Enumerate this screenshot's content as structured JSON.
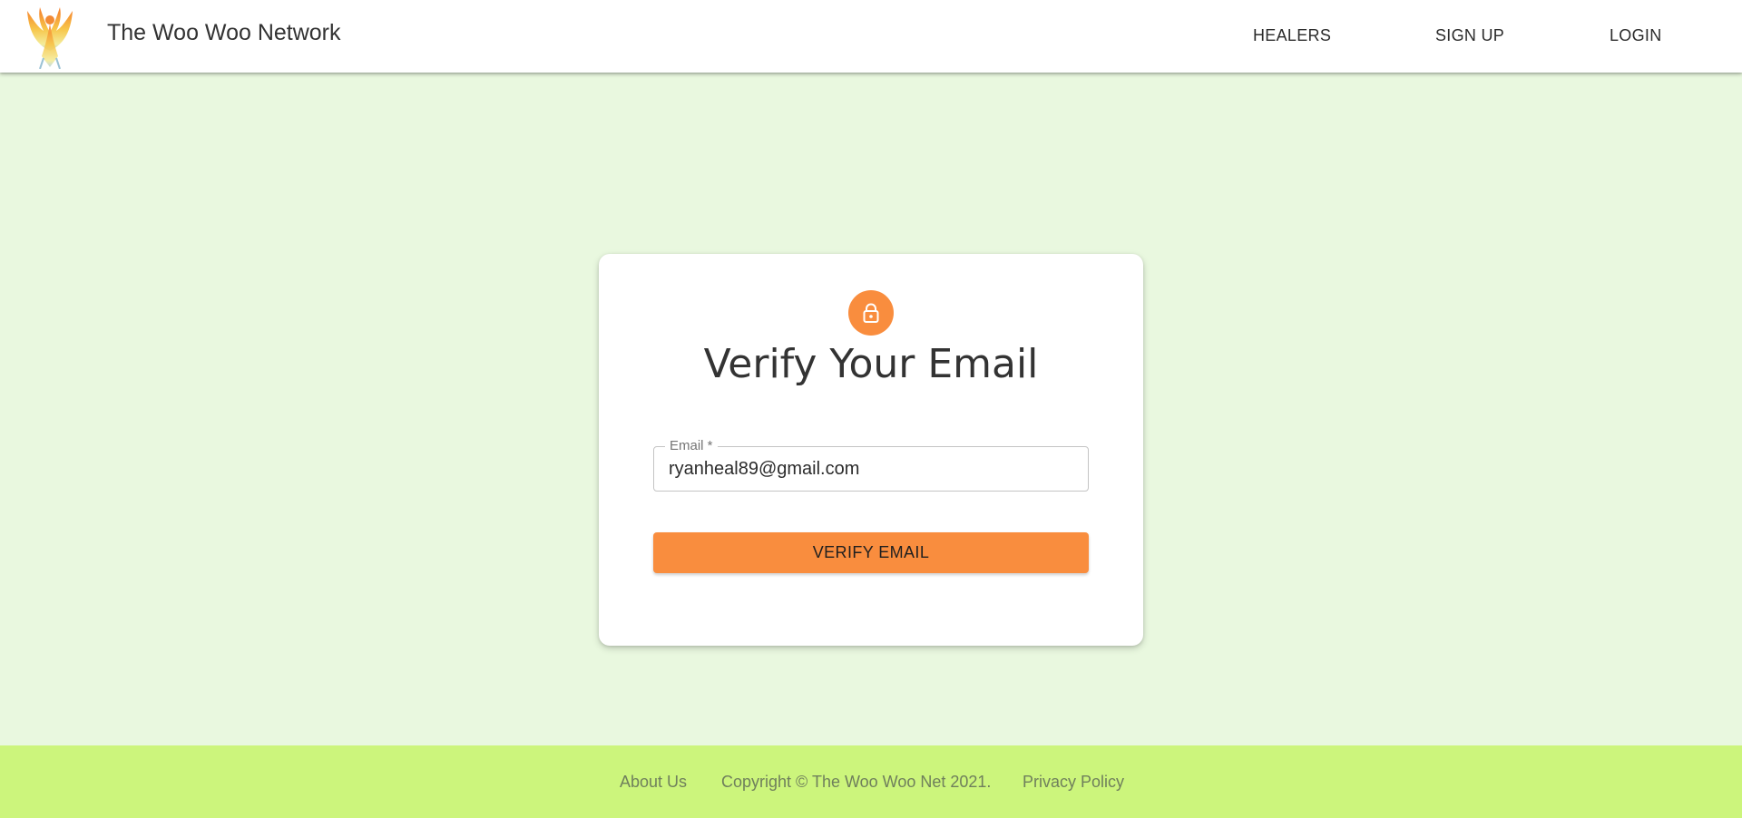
{
  "header": {
    "brand": "The Woo Woo Network",
    "logo_icon": "phoenix-logo-icon",
    "nav": {
      "healers": "HEALERS",
      "signup": "SIGN UP",
      "login": "LOGIN"
    }
  },
  "card": {
    "icon": "lock-icon",
    "title": "Verify Your Email",
    "email_label": "Email *",
    "email_value": "ryanheal89@gmail.com",
    "button_label": "VERIFY EMAIL"
  },
  "footer": {
    "about": "About Us",
    "copyright": "Copyright © The Woo Woo Net 2021.",
    "privacy": "Privacy Policy"
  },
  "colors": {
    "page_bg": "#e9f8df",
    "accent": "#f98d3e",
    "footer_bg": "#ccf57c"
  }
}
